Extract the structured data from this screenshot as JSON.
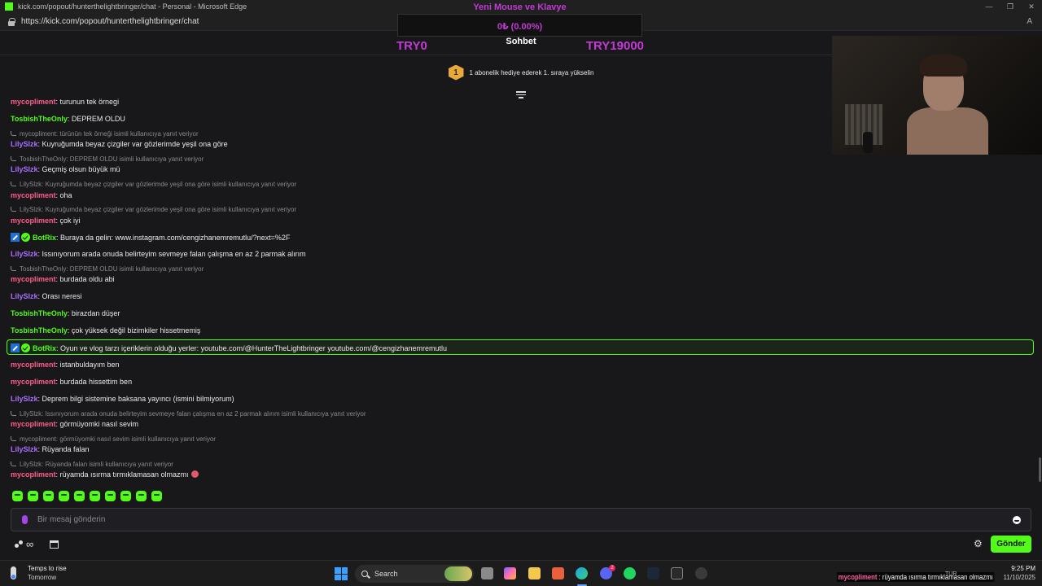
{
  "window": {
    "title": "kick.com/popout/hunterthelightbringer/chat - Personal - Microsoft Edge",
    "url": "https://kick.com/popout/hunterthelightbringer/chat",
    "min": "—",
    "max": "❐",
    "close": "✕"
  },
  "chat": {
    "title": "Sohbet"
  },
  "goal": {
    "title": "Yeni Mouse ve Klavye",
    "progress_text": "0₺ (0.00%)",
    "progress_fraction": 0.0,
    "min_label": "TRY0",
    "max_label": "TRY19000"
  },
  "promo": {
    "badge_number": "1",
    "text": "1 abonelik hediye ederek 1. sıraya yükselin"
  },
  "colors": {
    "accent": "#53fc18",
    "mycopliment": "#ff5c8a",
    "tosbish": "#53fc18",
    "lily": "#a970ff",
    "botrix": "#53fc18",
    "goal": "#c23bd4"
  },
  "messages": [
    {
      "user": "mycopliment",
      "text": ": turunun tek örnegi"
    },
    {
      "user": "TosbishTheOnly",
      "text": ": DEPREM OLDU"
    },
    {
      "reply": "mycopliment: türünün tek örneği isimli kullanıcıya yanıt veriyor"
    },
    {
      "user": "LilySlzk",
      "text": ": Kuyruğumda beyaz çizgiler var gözlerimde yeşil ona göre"
    },
    {
      "reply": "TosbishTheOnly: DEPREM OLDU isimli kullanıcıya yanıt veriyor"
    },
    {
      "user": "LilySlzk",
      "text": ": Geçmiş olsun büyük mü"
    },
    {
      "reply": "LilySlzk: Kuyruğumda beyaz çizgiler var gözlerimde yeşil ona göre isimli kullanıcıya yanıt veriyor"
    },
    {
      "user": "mycopliment",
      "text": ": oha"
    },
    {
      "reply": "LilySlzk: Kuyruğumda beyaz çizgiler var gözlerimde yeşil ona göre isimli kullanıcıya yanıt veriyor"
    },
    {
      "user": "mycopliment",
      "text": ": çok iyi"
    },
    {
      "user": "BotRix",
      "text": ": Buraya da gelin: www.instagram.com/cengizhanemremutlu/?next=%2F"
    },
    {
      "user": "LilySlzk",
      "text": ": Issınıyorum arada onuda belirteyim sevmeye falan çalışma en az 2 parmak alırım"
    },
    {
      "reply": "TosbishTheOnly: DEPREM OLDU isimli kullanıcıya yanıt veriyor"
    },
    {
      "user": "mycopliment",
      "text": ": burdada oldu abi"
    },
    {
      "user": "LilySlzk",
      "text": ": Orası neresi"
    },
    {
      "user": "TosbishTheOnly",
      "text": ": birazdan düşer"
    },
    {
      "user": "TosbishTheOnly",
      "text": ": çok yüksek değil bizimkiler hissetmemiş"
    },
    {
      "user": "BotRix",
      "text": ": Oyun ve vlog tarzı içeriklerin olduğu yerler: youtube.com/@HunterTheLightbringer youtube.com/@cengizhanemremutlu"
    },
    {
      "user": "mycopliment",
      "text": ": istanbuldayım ben"
    },
    {
      "user": "mycopliment",
      "text": ": burdada hissettim ben"
    },
    {
      "user": "LilySlzk",
      "text": ": Deprem bilgi sistemine baksana yayıncı (ismini bilmiyorum)"
    },
    {
      "reply": "LilySlzk: Issınıyorum arada onuda belirteyim sevmeye falan çalışma en az 2 parmak alırım isimli kullanıcıya yanıt veriyor"
    },
    {
      "user": "mycopliment",
      "text": ": görmüyomki nasıl sevim"
    },
    {
      "reply": "mycopliment: görmüyomki nasıl sevim isimli kullanıcıya yanıt veriyor"
    },
    {
      "user": "LilySlzk",
      "text": ": Rüyanda falan"
    },
    {
      "reply": "LilySlzk: Rüyanda falan isimli kullanıcıya yanıt veriyor"
    },
    {
      "user": "mycopliment",
      "text": ": rüyamda ısırma tırmıklamasan olmazmı"
    }
  ],
  "input": {
    "placeholder": "Bir mesaj gönderin",
    "value": ""
  },
  "bottom": {
    "send_label": "Gönder",
    "infinity": "∞",
    "settings": "⚙"
  },
  "taskbar": {
    "weather_title": "Temps to rise",
    "weather_sub": "Tomorrow",
    "search_label": "Search",
    "discord_badge": "2",
    "tray_lang": "TUR",
    "time": "9:25 PM",
    "date": "11/10/2025",
    "overlay_user": "mycopliment",
    "overlay_text": " : rüyamda ısırma tırmıklamasan olmazmı"
  }
}
